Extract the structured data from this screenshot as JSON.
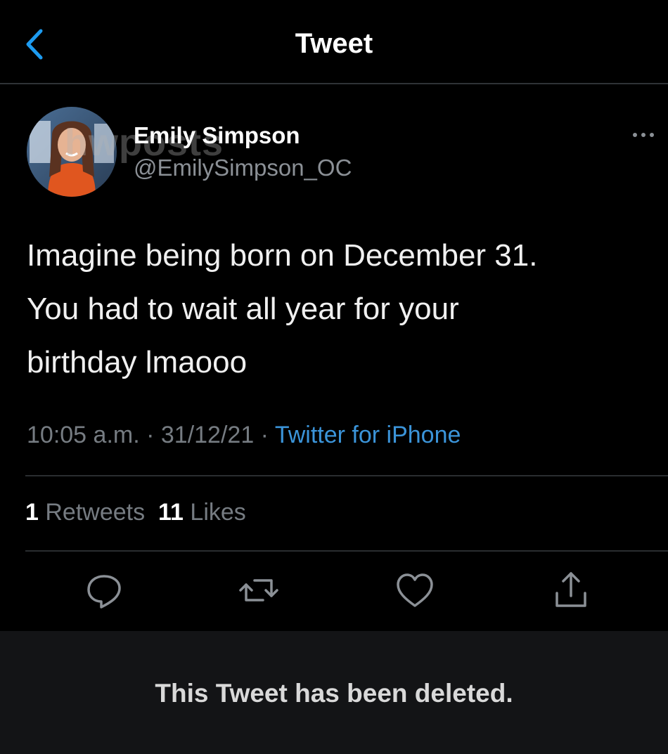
{
  "header": {
    "back_icon": "chevron-left-icon",
    "title": "Tweet"
  },
  "colors": {
    "accent": "#1d9bf0",
    "background": "#000000",
    "muted_text": "#767c82",
    "link": "#3b94d9",
    "deleted_banner_bg": "#131416"
  },
  "author": {
    "avatar_icon": "avatar-photo",
    "display_name": "Emily Simpson",
    "handle": "@EmilySimpson_OC",
    "watermark": "hwposts"
  },
  "more_icon": "ellipsis-icon",
  "tweet": {
    "lines": [
      "Imagine being born on December 31.",
      "You had to wait all year for your",
      "birthday lmaooo"
    ]
  },
  "meta": {
    "time": "10:05 a.m.",
    "sep1": " · ",
    "date": "31/12/21",
    "sep2": " · ",
    "source": "Twitter for iPhone"
  },
  "stats": {
    "retweets_count": "1",
    "retweets_label": "Retweets",
    "likes_count": "11",
    "likes_label": "Likes"
  },
  "actions": [
    {
      "name": "reply",
      "icon": "reply-icon"
    },
    {
      "name": "retweet",
      "icon": "retweet-icon"
    },
    {
      "name": "like",
      "icon": "heart-icon"
    },
    {
      "name": "share",
      "icon": "share-icon"
    }
  ],
  "deleted_notice": "This Tweet has been deleted."
}
